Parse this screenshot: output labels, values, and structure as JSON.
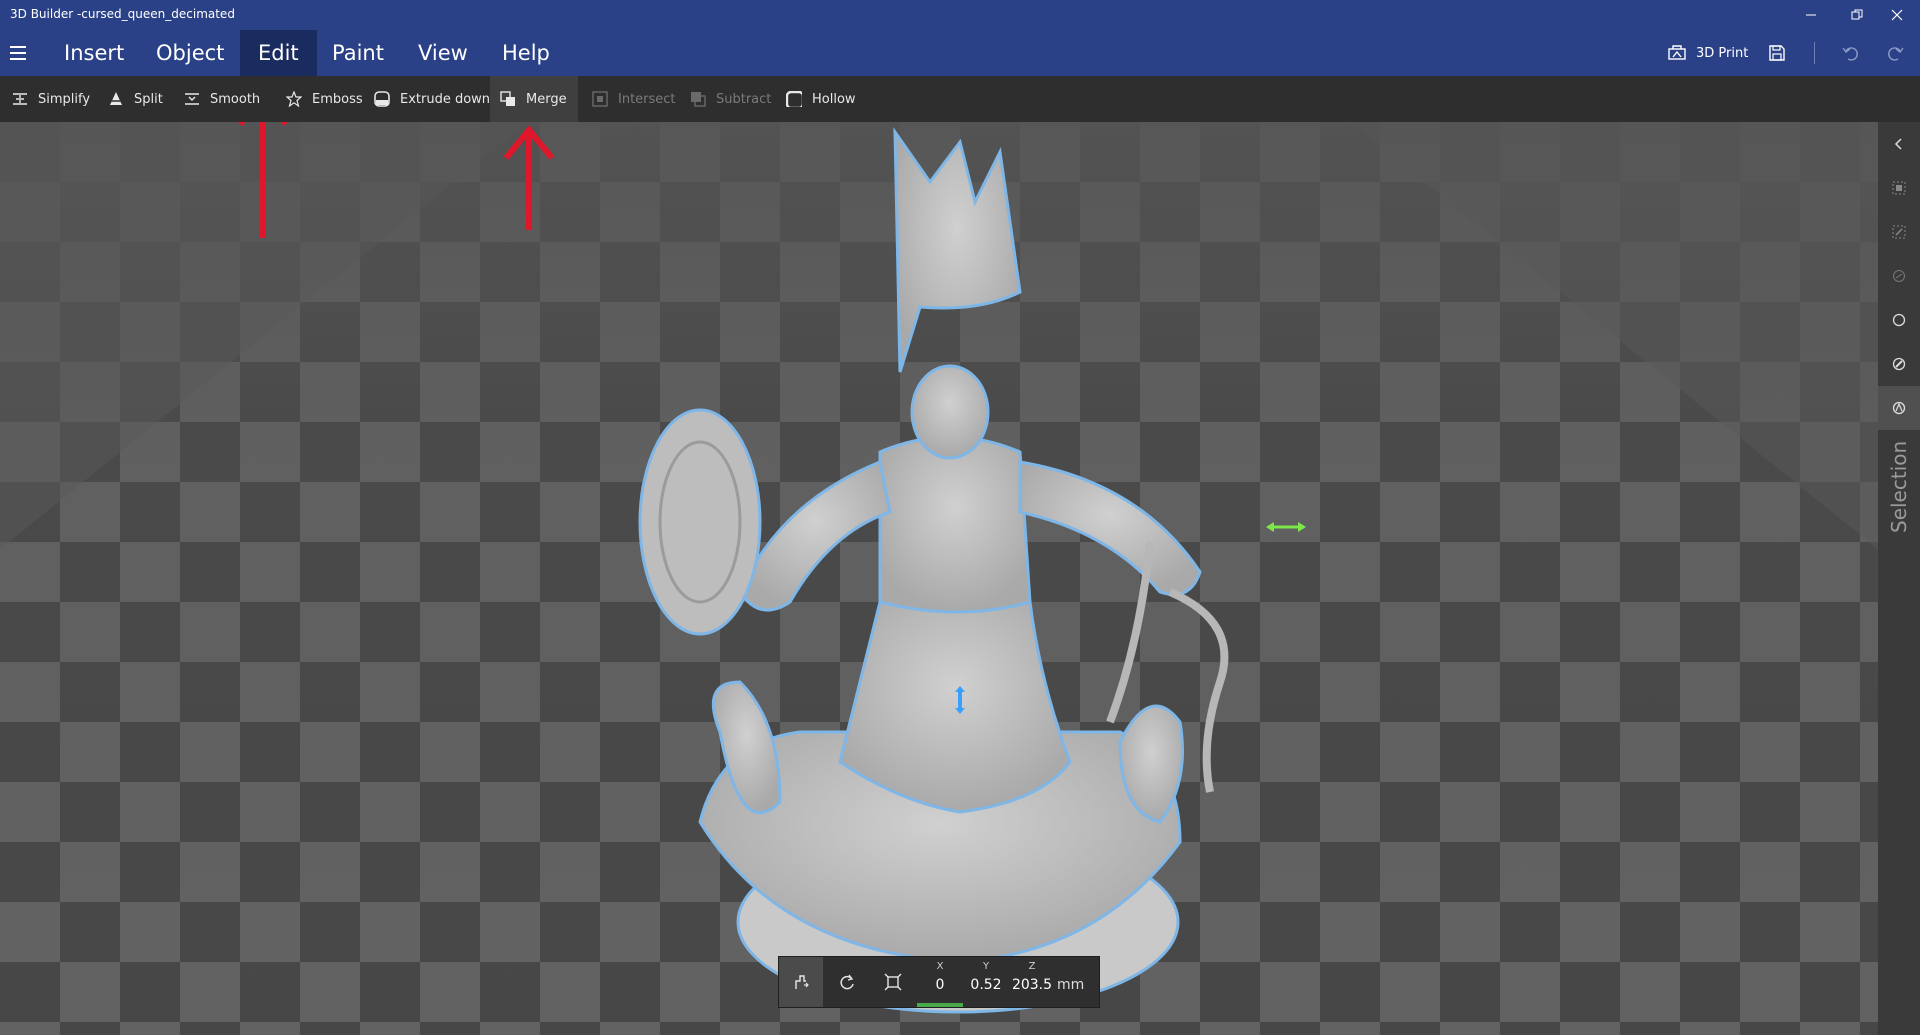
{
  "window": {
    "title": "3D Builder -cursed_queen_decimated"
  },
  "menu": {
    "items": [
      {
        "label": "Insert"
      },
      {
        "label": "Object"
      },
      {
        "label": "Edit"
      },
      {
        "label": "Paint"
      },
      {
        "label": "View"
      },
      {
        "label": "Help"
      }
    ],
    "active": "Edit",
    "print_label": "3D Print"
  },
  "ribbon": {
    "tools": [
      {
        "label": "Simplify",
        "icon": "simplify-icon",
        "enabled": true
      },
      {
        "label": "Split",
        "icon": "split-icon",
        "enabled": true
      },
      {
        "label": "Smooth",
        "icon": "smooth-icon",
        "enabled": true
      },
      {
        "label": "Emboss",
        "icon": "star-icon",
        "enabled": true
      },
      {
        "label": "Extrude down",
        "icon": "extrude-down-icon",
        "enabled": true
      },
      {
        "label": "Merge",
        "icon": "merge-icon",
        "enabled": true,
        "active": true
      },
      {
        "label": "Intersect",
        "icon": "intersect-icon",
        "enabled": false
      },
      {
        "label": "Subtract",
        "icon": "subtract-icon",
        "enabled": false
      },
      {
        "label": "Hollow",
        "icon": "hollow-icon",
        "enabled": true
      }
    ]
  },
  "sidepanel": {
    "label": "Selection",
    "icons": [
      "chevron-left-icon",
      "select-objects-icon",
      "select-faces-icon",
      "select-edges-icon",
      "circle-icon",
      "brush-icon",
      "selection-mode-icon"
    ]
  },
  "coords": {
    "x_label": "X",
    "x": "0",
    "y_label": "Y",
    "y": "0.52",
    "z_label": "Z",
    "z": "203.5",
    "unit": "mm"
  },
  "colors": {
    "titlebar": "#2b4187",
    "ribbon": "#2e2e2e",
    "annotation": "#e0162b",
    "gizmo_green": "#7de84a",
    "gizmo_blue": "#3aa0ff"
  }
}
